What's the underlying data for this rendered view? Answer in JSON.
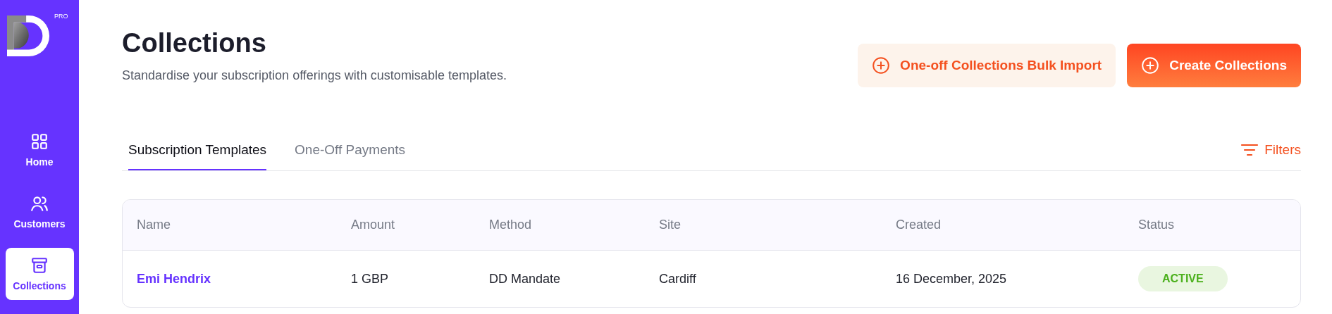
{
  "brand": {
    "badge": "PRO"
  },
  "sidebar": {
    "items": [
      {
        "label": "Home",
        "kind": "grid",
        "selected": false
      },
      {
        "label": "Customers",
        "kind": "users",
        "selected": false
      },
      {
        "label": "Collections",
        "kind": "archive",
        "selected": true
      }
    ]
  },
  "header": {
    "title": "Collections",
    "subtitle": "Standardise your subscription offerings with customisable templates.",
    "buttons": [
      {
        "label": "One-off Collections Bulk Import",
        "kind": "secondary"
      },
      {
        "label": "Create Collections",
        "kind": "primary"
      }
    ]
  },
  "tabs": [
    {
      "label": "Subscription Templates",
      "selected": true
    },
    {
      "label": "One-Off Payments",
      "selected": false
    }
  ],
  "filters": {
    "label": "Filters"
  },
  "table": {
    "columns": [
      "Name",
      "Amount",
      "Method",
      "Site",
      "Created",
      "Status"
    ],
    "rows": [
      {
        "name": "Emi Hendrix",
        "amount": "1 GBP",
        "method": "DD Mandate",
        "site": "Cardiff",
        "created": "16 December, 2025",
        "status": "ACTIVE"
      }
    ]
  }
}
